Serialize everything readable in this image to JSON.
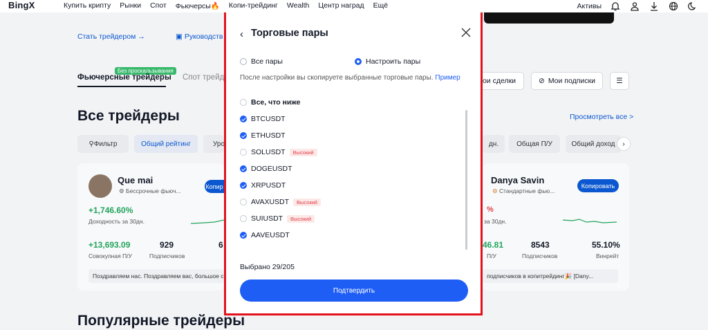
{
  "nav": {
    "logo": "BingX",
    "items": [
      "Купить крипту",
      "Рынки",
      "Спот",
      "Фьючерсы🔥",
      "Копи-трейдинг",
      "Wealth",
      "Центр наград",
      "Ещё"
    ],
    "assets": "Активы"
  },
  "page": {
    "become_trader": "Стать трейдером →",
    "guide": "Руководств",
    "tabs": [
      "Фьючерсные трейдеры",
      "Спот трейд"
    ],
    "badge": "Без проскальзывания",
    "my_deals": "ои сделки",
    "my_subs": "Мои подписки",
    "all_traders_title": "Все трейдеры",
    "see_all": "Просмотреть все >",
    "filter": "Фильтр",
    "overall_rating": "Общий рейтинг",
    "chip_uro": "Уро",
    "chip_dn": "дн.",
    "chip_pnl": "Общая П/У",
    "chip_income": "Общий доход",
    "popular_title": "Популярные трейдеры",
    "card_left": {
      "name": "Que mai",
      "tier": "Бессрочные фьюч...",
      "copy": "Копир",
      "roi": "+1,746.60%",
      "roi_label": "Доходность за 30дн.",
      "pnl": "+13,693.09",
      "pnl_label": "Совокупная П/У",
      "subs": "929",
      "subs_label": "Подписчиков",
      "partial": "6",
      "message": "Поздравляем нас. Поздравляем вас, большое с"
    },
    "card_right": {
      "name": "Danya Savin",
      "tier": "Стандартные фью...",
      "copy": "Копировать",
      "roi": "%",
      "roi_label": "за 30дн.",
      "pnl": "46.81",
      "pnl_label": "П/У",
      "subs": "8543",
      "subs_label": "Подписчиков",
      "win": "55.10%",
      "win_label": "Винрейт",
      "message": "подписчиков в копитрейдинг🎉 [Dany..."
    }
  },
  "modal": {
    "title": "Торговые пары",
    "opt_all": "Все пары",
    "opt_custom": "Настроить пары",
    "note": "После настройки вы скопируете выбранные торговые пары.",
    "example": "Пример",
    "select_all": "Все, что ниже",
    "pairs": [
      {
        "name": "BTCUSDT",
        "checked": true,
        "tag": ""
      },
      {
        "name": "ETHUSDT",
        "checked": true,
        "tag": ""
      },
      {
        "name": "SOLUSDT",
        "checked": false,
        "tag": "Высокий"
      },
      {
        "name": "DOGEUSDT",
        "checked": true,
        "tag": ""
      },
      {
        "name": "XRPUSDT",
        "checked": true,
        "tag": ""
      },
      {
        "name": "AVAXUSDT",
        "checked": false,
        "tag": "Высокий"
      },
      {
        "name": "SUIUSDT",
        "checked": false,
        "tag": "Высокий"
      },
      {
        "name": "AAVEUSDT",
        "checked": true,
        "tag": ""
      }
    ],
    "selected": "Выбрано 29/205",
    "confirm": "Подтвердить"
  },
  "colors": {
    "accent": "#1e5ef5",
    "highlight": "#e3111b",
    "green": "#22a45d"
  }
}
